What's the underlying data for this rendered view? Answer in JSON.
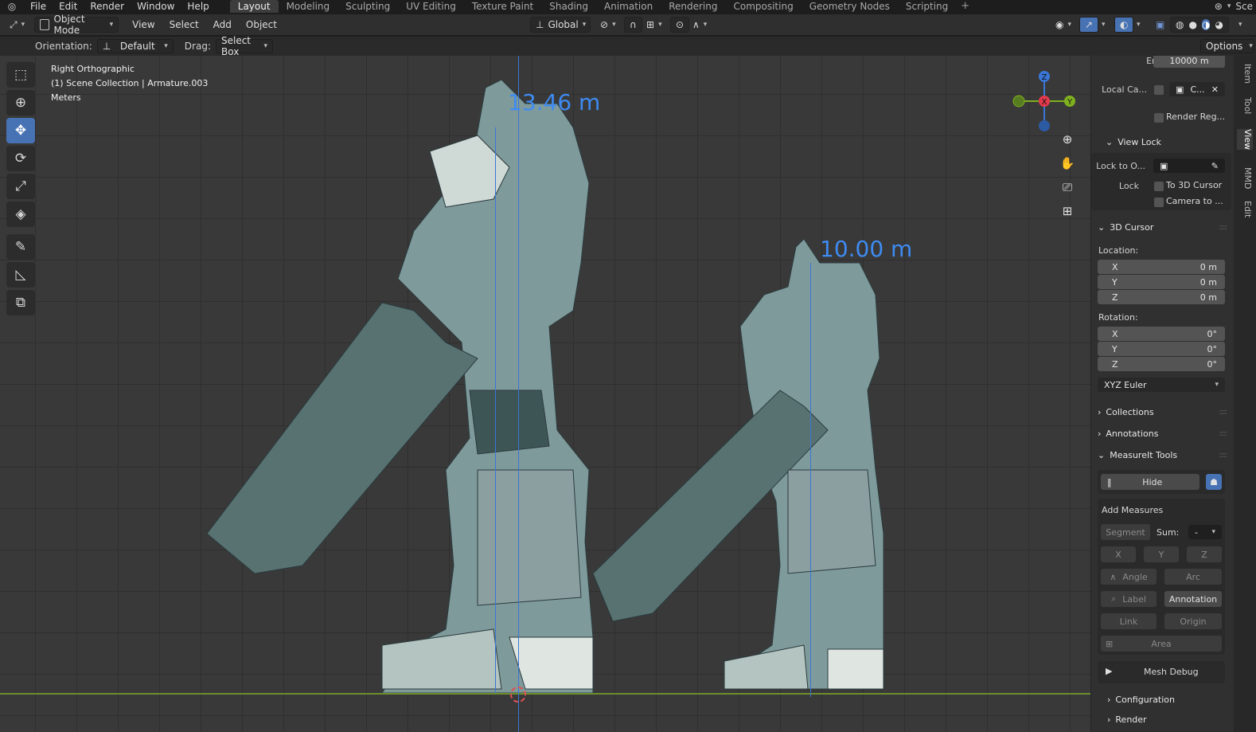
{
  "topbar": {
    "menu": [
      "File",
      "Edit",
      "Render",
      "Window",
      "Help"
    ],
    "workspaces": [
      "Layout",
      "Modeling",
      "Sculpting",
      "UV Editing",
      "Texture Paint",
      "Shading",
      "Animation",
      "Rendering",
      "Compositing",
      "Geometry Nodes",
      "Scripting"
    ],
    "active_workspace": "Layout",
    "add_symbol": "+",
    "scene_label": "Sce"
  },
  "header": {
    "mode": "Object Mode",
    "menus": [
      "View",
      "Select",
      "Add",
      "Object"
    ],
    "transform_orientation": "Global"
  },
  "toolsettings": {
    "orientation_label": "Orientation:",
    "orientation_value": "Default",
    "drag_label": "Drag:",
    "drag_value": "Select Box",
    "options": "Options"
  },
  "viewport": {
    "view_name": "Right Orthographic",
    "collection": "(1) Scene Collection | Armature.003",
    "units": "Meters",
    "measure_large": "13.46 m",
    "measure_small": "10.00 m",
    "gizmo": {
      "z": "Z",
      "x": "X",
      "y": "Y"
    }
  },
  "npanel": {
    "end_label": "End",
    "end_value": "10000 m",
    "local_camera_label": "Local Ca...",
    "local_camera_value": "C...",
    "render_region": "Render Reg...",
    "view_lock_title": "View Lock",
    "lock_to_object_label": "Lock to O...",
    "lock_label": "Lock",
    "lock_to_cursor": "To 3D Cursor",
    "camera_to": "Camera to ...",
    "cursor_title": "3D Cursor",
    "location_label": "Location:",
    "location": [
      {
        "axis": "X",
        "value": "0 m"
      },
      {
        "axis": "Y",
        "value": "0 m"
      },
      {
        "axis": "Z",
        "value": "0 m"
      }
    ],
    "rotation_label": "Rotation:",
    "rotation": [
      {
        "axis": "X",
        "value": "0°"
      },
      {
        "axis": "Y",
        "value": "0°"
      },
      {
        "axis": "Z",
        "value": "0°"
      }
    ],
    "rotation_mode": "XYZ Euler",
    "collections": "Collections",
    "annotations": "Annotations",
    "measureit_title": "MeasureIt Tools",
    "hide": "Hide",
    "add_measures": "Add Measures",
    "segment": "Segment",
    "sum_label": "Sum:",
    "sum_value": "-",
    "x": "X",
    "y": "Y",
    "z": "Z",
    "angle": "Angle",
    "arc": "Arc",
    "label": "Label",
    "annotation": "Annotation",
    "link": "Link",
    "origin": "Origin",
    "area": "Area",
    "mesh_debug": "Mesh Debug",
    "configuration": "Configuration",
    "render": "Render"
  },
  "vtabs": [
    "Item",
    "Tool",
    "View",
    "MMD",
    "Edit"
  ]
}
